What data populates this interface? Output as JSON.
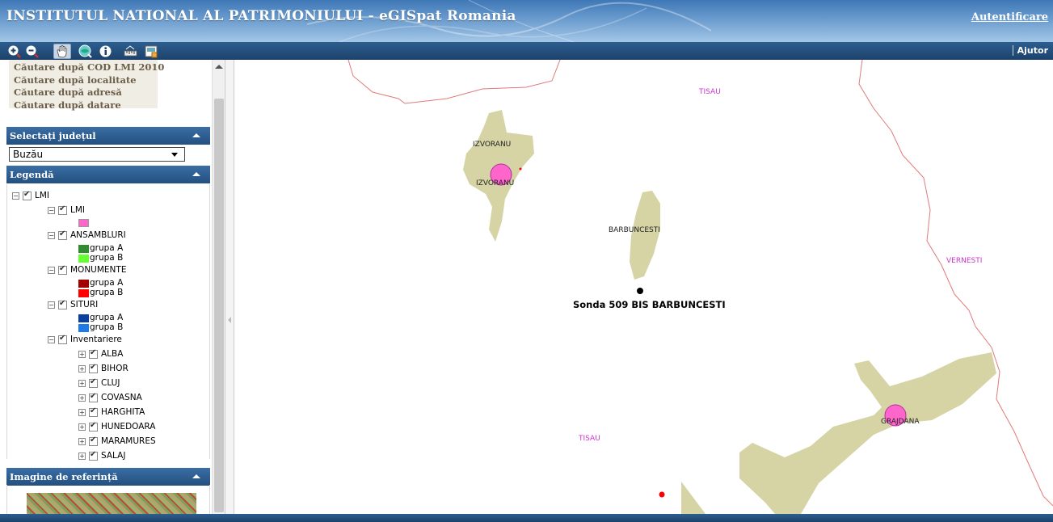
{
  "header": {
    "title": "INSTITUTUL NATIONAL AL PATRIMONIULUI - eGISpat Romania",
    "login_label": "Autentificare"
  },
  "toolbar": {
    "tools": [
      "zoom-in-icon",
      "zoom-out-icon",
      "pan-hand-icon",
      "zoom-extent-icon",
      "info-icon",
      "measure-icon",
      "print-icon"
    ],
    "help_label": "Ajutor"
  },
  "search": {
    "links": [
      "Căutare după COD LMI 2010",
      "Căutare după localitate",
      "Căutare după adresă",
      "Căutare după datare"
    ]
  },
  "county_section": {
    "title": "Selectați județul",
    "selected": "Buzău"
  },
  "legend_section": {
    "title": "Legendă",
    "root": "LMI",
    "groups": [
      {
        "label": "LMI",
        "items": [
          {
            "label": "",
            "color": "#ff66cc"
          }
        ]
      },
      {
        "label": "ANSAMBLURI",
        "items": [
          {
            "label": "grupa A",
            "color": "#2e8b2e"
          },
          {
            "label": "grupa B",
            "color": "#66ff33"
          }
        ]
      },
      {
        "label": "MONUMENTE",
        "items": [
          {
            "label": "grupa A",
            "color": "#a00000"
          },
          {
            "label": "grupa B",
            "color": "#ff0000"
          }
        ]
      },
      {
        "label": "SITURI",
        "items": [
          {
            "label": "grupa A",
            "color": "#0a3fa0"
          },
          {
            "label": "grupa B",
            "color": "#1e7be6"
          }
        ]
      }
    ],
    "inventory_label": "Inventariere",
    "inventory_counties": [
      "ALBA",
      "BIHOR",
      "CLUJ",
      "COVASNA",
      "HARGHITA",
      "HUNEDOARA",
      "MARAMURES",
      "SALAJ"
    ]
  },
  "reference_section": {
    "title": "Imagine de referință"
  },
  "map": {
    "labels": {
      "tisau_top": "TISAU",
      "izvoranu_1": "IZVORANU",
      "izvoranu_2": "IZVORANU",
      "barbuncesti": "BARBUNCESTI",
      "vernesti": "VERNESTI",
      "sonda": "Sonda 509 BIS BARBUNCESTI",
      "tisau_bottom": "TISAU",
      "grajdana": "GRAJDANA"
    },
    "colors": {
      "settlement": "#d6d3a4",
      "boundary": "#e07a7a",
      "commune_label": "#cc33cc",
      "lmi_point": "#ff66cc"
    }
  }
}
